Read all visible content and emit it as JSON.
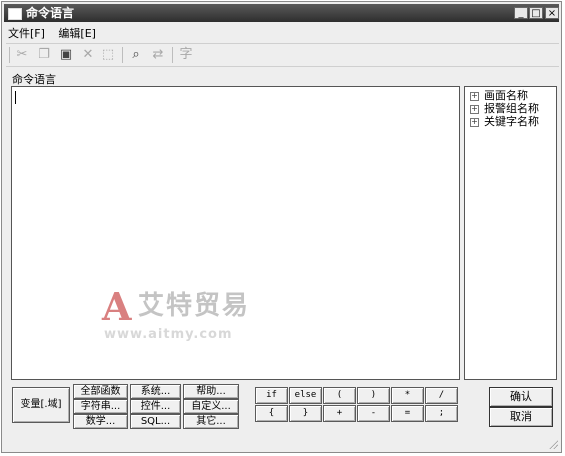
{
  "window": {
    "title": "命令语言",
    "controls": {
      "minimize": "_",
      "maximize": "□",
      "close": "×"
    }
  },
  "menu": [
    {
      "label": "文件[F]"
    },
    {
      "label": "编辑[E]"
    }
  ],
  "toolbar": {
    "icons": [
      "cut-icon",
      "copy-icon",
      "paste-icon",
      "delete-icon",
      "select-all-icon",
      "find-icon",
      "replace-icon",
      "font-icon"
    ]
  },
  "section_label": "命令语言",
  "tree": {
    "items": [
      {
        "expander": "+",
        "label": "画面名称"
      },
      {
        "expander": "+",
        "label": "报警组名称"
      },
      {
        "expander": "+",
        "label": "关键字名称"
      }
    ]
  },
  "bottom": {
    "variable_button": "变量[.域]",
    "function_buttons": [
      [
        "全部函数",
        "系统...",
        "帮助..."
      ],
      [
        "字符串...",
        "控件...",
        "自定义..."
      ],
      [
        "数学...",
        "SQL...",
        "其它..."
      ]
    ],
    "operator_rows": [
      [
        "if",
        "else",
        "(",
        ")",
        "*",
        "/"
      ],
      [
        "{",
        "}",
        "+",
        "-",
        "=",
        ";"
      ]
    ],
    "ok": "确认",
    "cancel": "取消"
  },
  "watermark": {
    "logo": "A",
    "name": "艾特贸易",
    "url": "www.aitmy.com"
  }
}
